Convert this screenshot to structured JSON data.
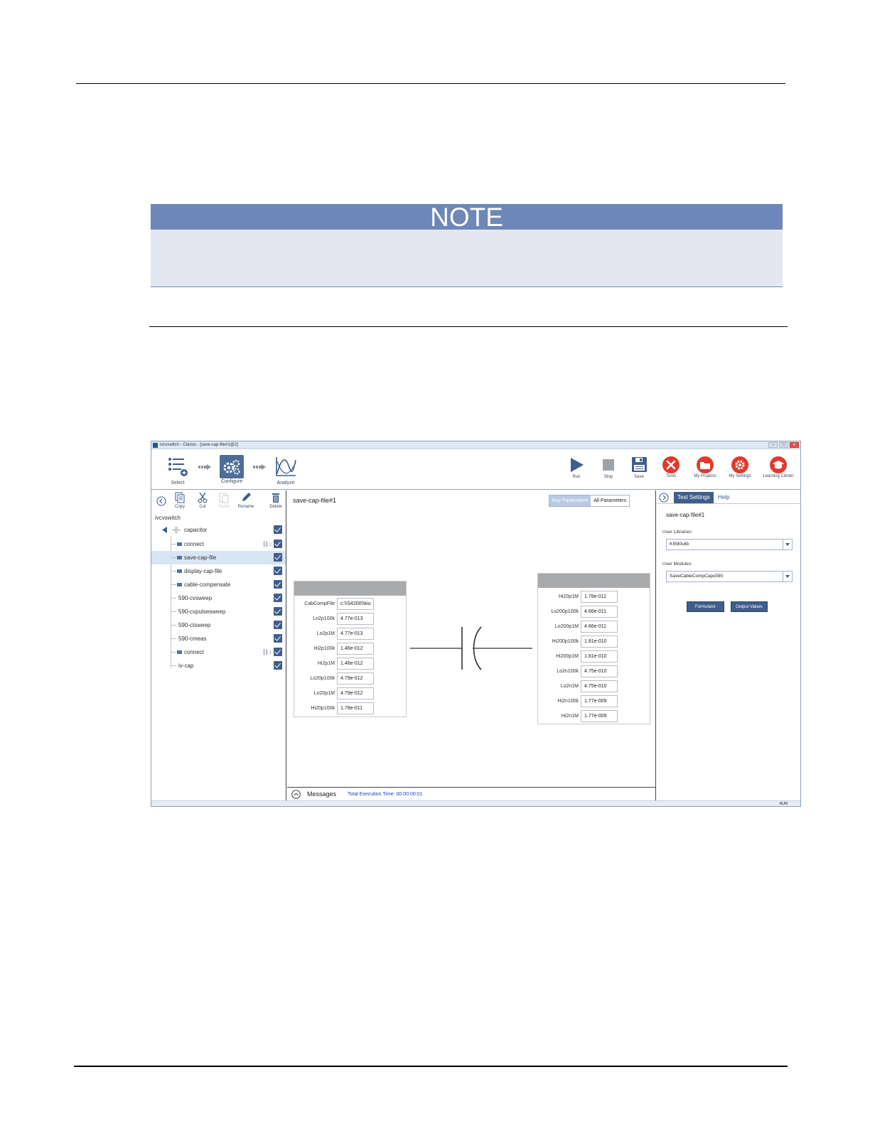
{
  "note": {
    "heading": "NOTE"
  },
  "window": {
    "title": "ivcvswitch - Clarius - [save-cap-file#1@2]",
    "min": "–",
    "max": "□",
    "close": "x"
  },
  "toolbar": {
    "select_label": "Select",
    "configure_label": "Configure",
    "analyze_label": "Analyze",
    "run_label": "Run",
    "stop_label": "Stop",
    "save_label": "Save",
    "tools_label": "Tools",
    "my_projects_label": "My Projects",
    "my_settings_label": "My Settings",
    "learning_center_label": "Learning Center"
  },
  "left_panel": {
    "tools": {
      "copy": "Copy",
      "cut": "Cut",
      "paste": "Paste",
      "rename": "Rename",
      "delete": "Delete"
    },
    "project_name": "ivcvswitch",
    "tree": [
      {
        "label": "capacitor",
        "checked": true
      },
      {
        "label": "connect",
        "checked": true,
        "link_count": "2"
      },
      {
        "label": "save-cap-file",
        "checked": true,
        "selected": true
      },
      {
        "label": "display-cap-file",
        "checked": true
      },
      {
        "label": "cable-compensate",
        "checked": true
      },
      {
        "label": "590-cvsweep",
        "checked": true
      },
      {
        "label": "590-cvpulsesweep",
        "checked": true
      },
      {
        "label": "590-ctsweep",
        "checked": true
      },
      {
        "label": "590-cmeas",
        "checked": true
      },
      {
        "label": "connect",
        "checked": true,
        "link_count": "1"
      },
      {
        "label": "iv-cap",
        "checked": true
      }
    ]
  },
  "center": {
    "title": "save-cap-file#1",
    "view_key": "Key Parameters",
    "view_all": "All Parameters",
    "left_params": [
      {
        "label": "CabCompFile",
        "value": "c:\\\\S4200\\\\kiu"
      },
      {
        "label": "Lo2p100k",
        "value": "4.77e-013"
      },
      {
        "label": "Lo2p1M",
        "value": "4.77e-013"
      },
      {
        "label": "Hi2p100k",
        "value": "1.46e-012"
      },
      {
        "label": "Hi2p1M",
        "value": "1.46e-012"
      },
      {
        "label": "Lo20p100k",
        "value": "4.79e-012"
      },
      {
        "label": "Lo20p1M",
        "value": "4.79e-012"
      },
      {
        "label": "Hi20p100k",
        "value": "1.78e-011"
      }
    ],
    "right_params": [
      {
        "label": "Hi20p1M",
        "value": "1.78e-011"
      },
      {
        "label": "Lo200p100k",
        "value": "4.66e-011"
      },
      {
        "label": "Lo200p1M",
        "value": "4.66e-011"
      },
      {
        "label": "Hi200p100k",
        "value": "1.81e-010"
      },
      {
        "label": "Hi200p1M",
        "value": "1.81e-010"
      },
      {
        "label": "Lo2n100k",
        "value": "4.75e-010"
      },
      {
        "label": "Lo2n1M",
        "value": "4.75e-010"
      },
      {
        "label": "Hi2n100k",
        "value": "1.77e-009"
      },
      {
        "label": "Hi2n1M",
        "value": "1.77e-009"
      }
    ],
    "messages_label": "Messages",
    "execution_time": "Total Execution Time: 00:00:00:01"
  },
  "right_panel": {
    "tab_test_settings": "Test Settings",
    "tab_help": "Help",
    "test_name": "save-cap-file#1",
    "user_libraries_label": "User Libraries:",
    "user_libraries_value": "KI590ulib",
    "user_modules_label": "User Modules:",
    "user_modules_value": "SaveCableCompCaps590",
    "formulator_label": "Formulator",
    "output_values_label": "Output Values"
  },
  "status": {
    "num": "NUM"
  },
  "colors": {
    "accent": "#3f5e8c",
    "note_header": "#6d87b8",
    "note_body": "#e4e7f1",
    "red_icons": "#e03a2e"
  }
}
